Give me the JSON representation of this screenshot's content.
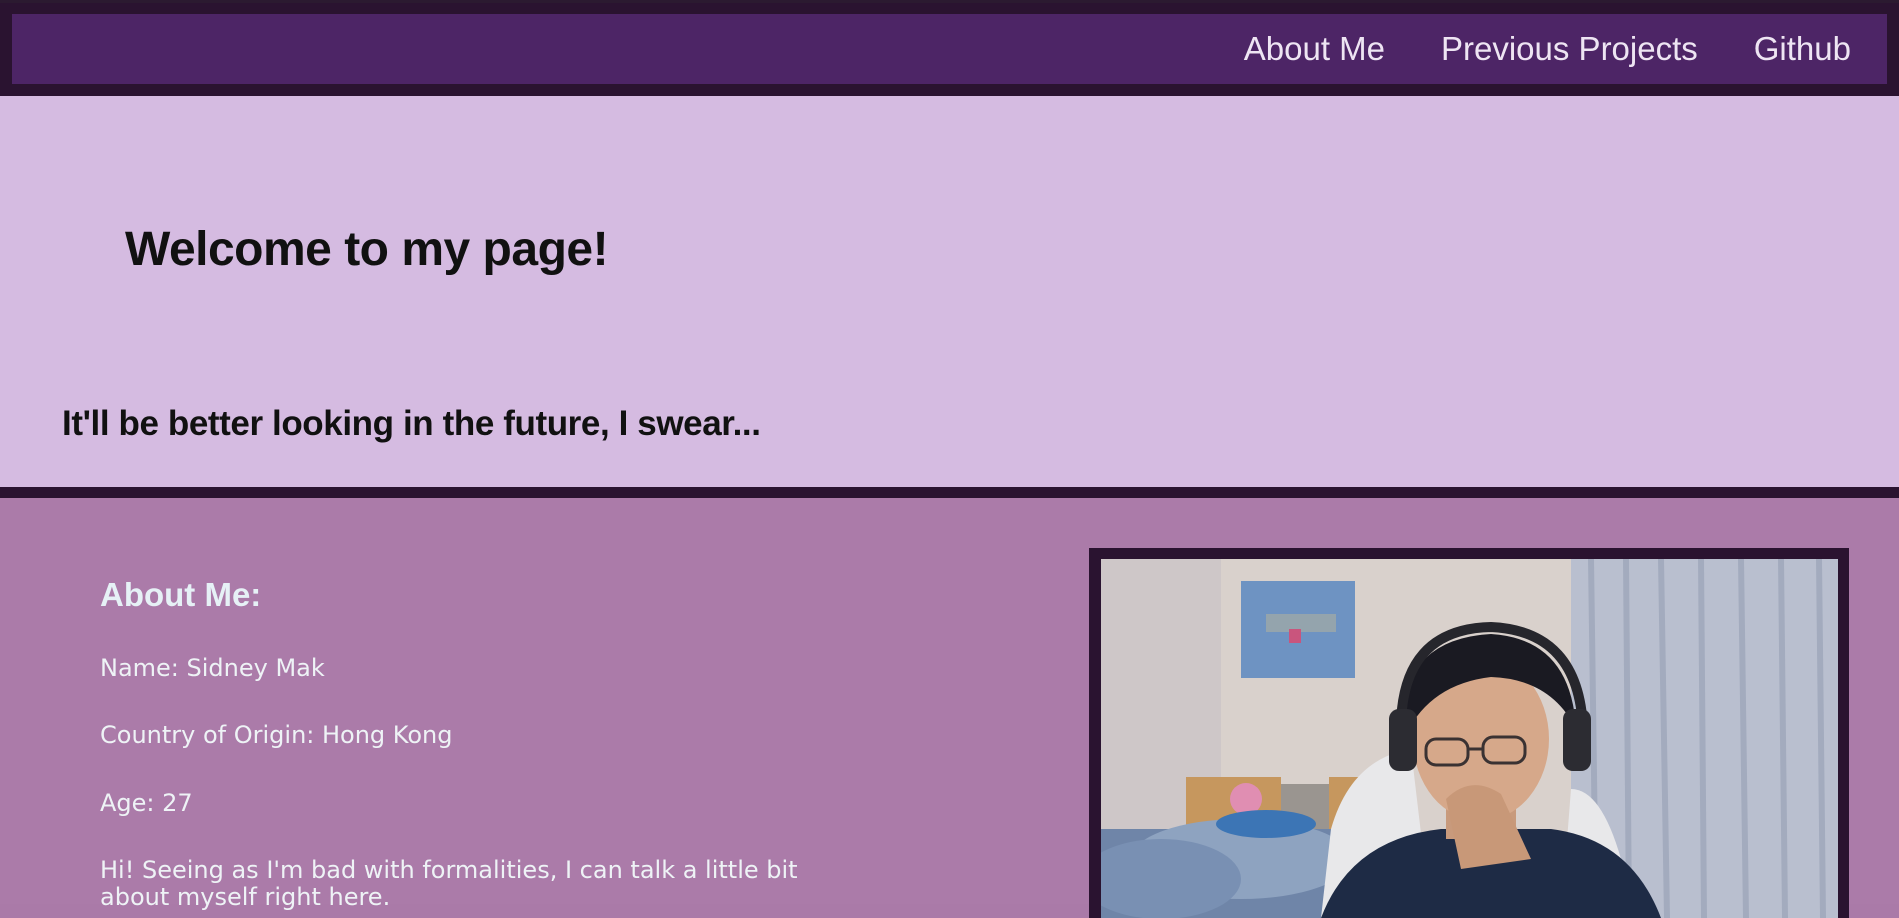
{
  "nav": {
    "links": [
      "About Me",
      "Previous Projects",
      "Github"
    ]
  },
  "hero": {
    "title": "Welcome to my page!",
    "subtitle": "It'll be better looking in the future, I swear..."
  },
  "about": {
    "heading": "About Me:",
    "name": "Name: Sidney Mak",
    "country": "Country of Origin: Hong Kong",
    "age": "Age: 27",
    "intro_line1": "Hi! Seeing as I'm bad with formalities, I can talk a little bit",
    "intro_line2": "about myself right here."
  },
  "colors": {
    "nav_bg": "#4d2566",
    "frame_dark": "#2a1330",
    "hero_bg": "#d5bbe1",
    "about_bg": "#ab7ba9",
    "about_text": "#eef3f6"
  }
}
